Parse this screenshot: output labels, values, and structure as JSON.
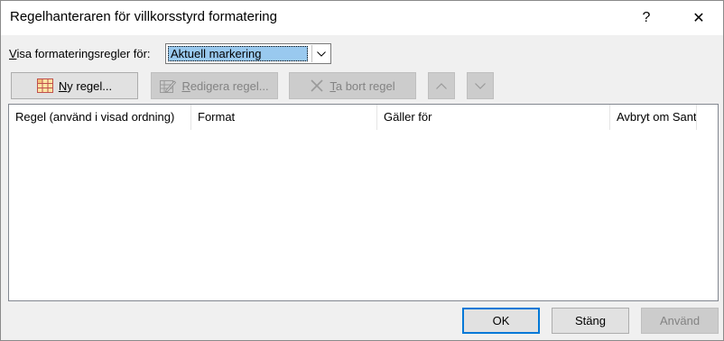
{
  "window": {
    "title": "Regelhanteraren för villkorsstyrd formatering",
    "help_glyph": "?",
    "close_glyph": "✕"
  },
  "show_rules": {
    "label_accesskey": "V",
    "label_rest": "isa formateringsregler för:",
    "selected": "Aktuell markering"
  },
  "toolbar": {
    "new_rule_accesskey": "N",
    "new_rule_rest": "y regel...",
    "edit_rule_accesskey": "R",
    "edit_rule_rest": "edigera regel...",
    "delete_rule_accesskey": "T",
    "delete_rule_rest": "a bort regel"
  },
  "rules_table": {
    "columns": [
      "Regel (använd i visad ordning)",
      "Format",
      "Gäller för",
      "Avbryt om Sant"
    ],
    "rows": []
  },
  "footer": {
    "ok_label": "OK",
    "close_label": "Stäng",
    "apply_label": "Använd"
  },
  "colors": {
    "accent": "#0078d7",
    "selection": "#99c9ef",
    "dialog_bg": "#f0f0f0"
  }
}
